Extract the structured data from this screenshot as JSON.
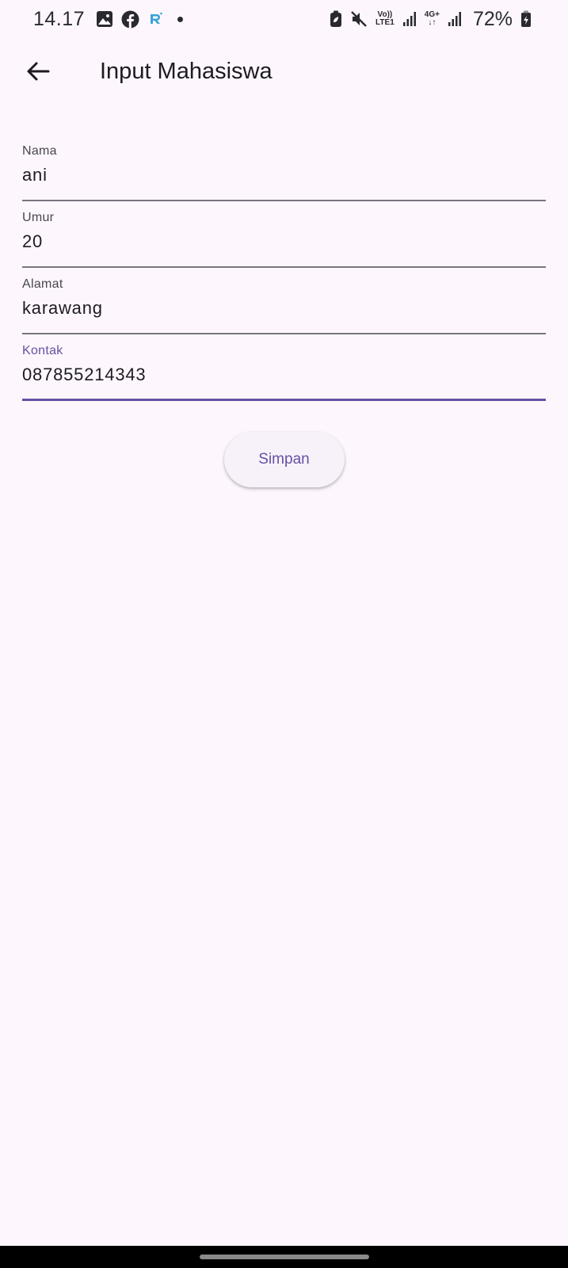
{
  "status_bar": {
    "time": "14.17",
    "volte_label": "Vo))",
    "lte_label": "LTE1",
    "net_label": "4G+",
    "battery_percent": "72%",
    "icons": [
      "gallery-icon",
      "facebook-icon",
      "app-r-icon",
      "notification-dot",
      "battery-saver-icon",
      "mute-icon",
      "signal-icon",
      "battery-icon"
    ]
  },
  "app_bar": {
    "title": "Input Mahasiswa",
    "back_icon": "arrow-back-icon"
  },
  "form": {
    "fields": [
      {
        "label": "Nama",
        "value": "ani"
      },
      {
        "label": "Umur",
        "value": "20"
      },
      {
        "label": "Alamat",
        "value": "karawang"
      },
      {
        "label": "Kontak",
        "value": "087855214343"
      }
    ],
    "focused_field": "Kontak"
  },
  "actions": {
    "save_label": "Simpan"
  },
  "colors": {
    "background": "#fdf7fd",
    "accent": "#6750a4",
    "text": "#1d1b20",
    "underline": "#79747e",
    "button_bg": "#f7f2f9"
  }
}
